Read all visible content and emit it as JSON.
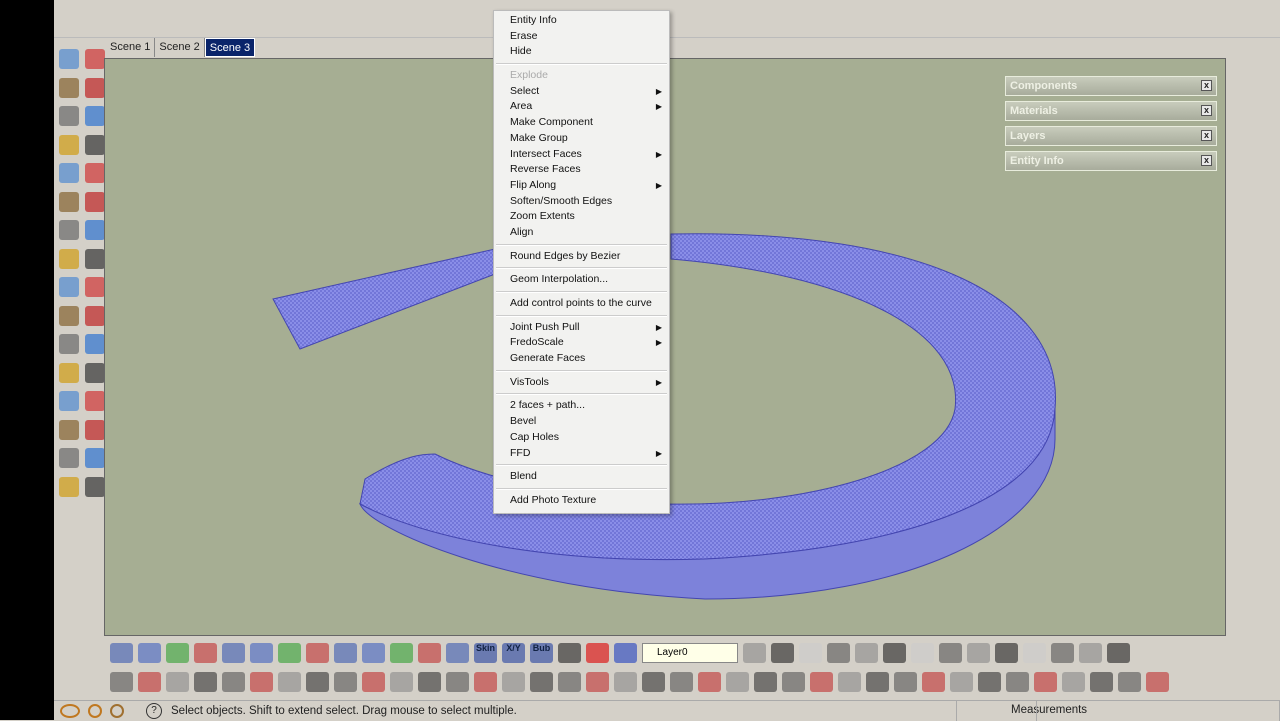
{
  "scenes": {
    "tabs": [
      {
        "label": "Scene 1"
      },
      {
        "label": "Scene 2"
      },
      {
        "label": "Scene 3",
        "active": true
      }
    ]
  },
  "trays": [
    {
      "label": "Components"
    },
    {
      "label": "Materials"
    },
    {
      "label": "Layers"
    },
    {
      "label": "Entity Info"
    }
  ],
  "tray_close": "x",
  "context_menu": {
    "items": [
      {
        "label": "Entity Info"
      },
      {
        "label": "Erase"
      },
      {
        "label": "Hide"
      },
      {
        "sep": true
      },
      {
        "label": "Explode",
        "disabled": true
      },
      {
        "label": "Select",
        "submenu": true
      },
      {
        "label": "Area",
        "submenu": true
      },
      {
        "label": "Make Component"
      },
      {
        "label": "Make Group"
      },
      {
        "label": "Intersect Faces",
        "submenu": true
      },
      {
        "label": "Reverse Faces"
      },
      {
        "label": "Flip Along",
        "submenu": true
      },
      {
        "label": "Soften/Smooth Edges"
      },
      {
        "label": "Zoom Extents"
      },
      {
        "label": "Align"
      },
      {
        "sep": true
      },
      {
        "label": "Round Edges by Bezier"
      },
      {
        "sep": true
      },
      {
        "label": "Geom Interpolation..."
      },
      {
        "sep": true
      },
      {
        "label": "Add control points to the curve"
      },
      {
        "sep": true
      },
      {
        "label": "Joint Push Pull",
        "submenu": true
      },
      {
        "label": "FredoScale",
        "submenu": true
      },
      {
        "label": "Generate Faces"
      },
      {
        "sep": true
      },
      {
        "label": "VisTools",
        "submenu": true
      },
      {
        "sep": true
      },
      {
        "label": "2 faces + path..."
      },
      {
        "label": "Bevel"
      },
      {
        "label": "Cap Holes"
      },
      {
        "label": "FFD",
        "submenu": true
      },
      {
        "sep": true
      },
      {
        "label": "Blend"
      },
      {
        "sep": true
      },
      {
        "label": "Add Photo Texture"
      }
    ]
  },
  "toolbar": {
    "layer_select": "Layer0",
    "skin": "Skin",
    "xy": "X/Y",
    "bub": "Bub"
  },
  "status": {
    "hint": "Select objects. Shift to extend select. Drag mouse to select multiple.",
    "measurements_label": "Measurements",
    "help_icon": "?"
  },
  "colors": {
    "viewport": "#a6ae93",
    "selection": "#7b7fe0",
    "active_tab": "#0a246a"
  }
}
